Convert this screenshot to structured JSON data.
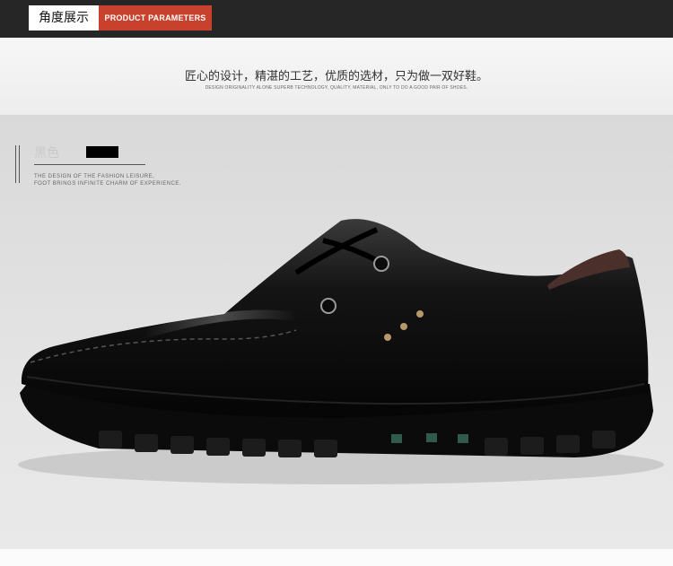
{
  "header": {
    "tab_cn": "角度展示",
    "tab_en": "PRODUCT PARAMETERS"
  },
  "intro": {
    "slogan_cn": "匠心的设计，精湛的工艺，优质的选材，只为做一双好鞋。",
    "slogan_en": "DESIGN ORIGINALITY ALONE SUPERB TECHNOLOGY, QUALITY, MATERIAL, ONLY TO DO A GOOD PAIR OF SHOES."
  },
  "product": {
    "color_label": "黑色",
    "swatch_color": "#000000",
    "desc_line1": "THE DESIGN OF THE FASHION LEISURE,",
    "desc_line2": "FOOT BRINGS INFINITE CHARM OF EXPERIENCE.",
    "image": "black-leather-casual-shoe"
  },
  "colors": {
    "header_bg": "#262626",
    "accent": "#c8412c"
  }
}
